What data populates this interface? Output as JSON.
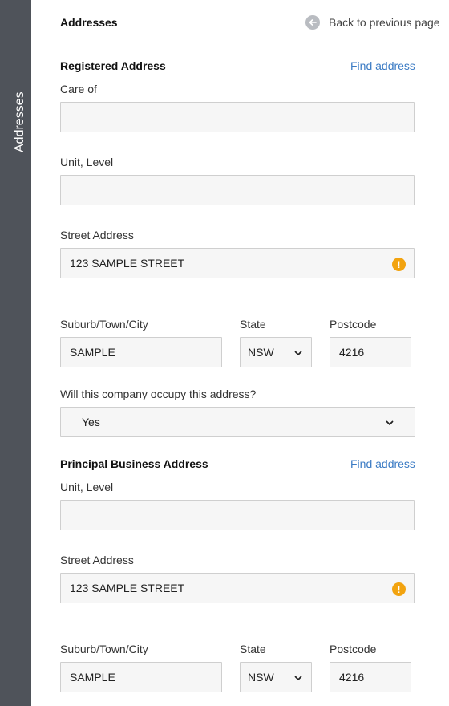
{
  "sidebar": {
    "label": "Addresses"
  },
  "header": {
    "title": "Addresses",
    "back_label": "Back to previous page"
  },
  "registered": {
    "title": "Registered Address",
    "find_label": "Find address",
    "care_of_label": "Care of",
    "care_of_value": "",
    "unit_label": "Unit, Level",
    "unit_value": "",
    "street_label": "Street Address",
    "street_value": "123 SAMPLE STREET",
    "suburb_label": "Suburb/Town/City",
    "suburb_value": "SAMPLE",
    "state_label": "State",
    "state_value": "NSW",
    "postcode_label": "Postcode",
    "postcode_value": "4216",
    "occupy_label": "Will this company occupy this address?",
    "occupy_value": "Yes"
  },
  "principal": {
    "title": "Principal Business Address",
    "find_label": "Find address",
    "unit_label": "Unit, Level",
    "unit_value": "",
    "street_label": "Street Address",
    "street_value": "123 SAMPLE STREET",
    "suburb_label": "Suburb/Town/City",
    "suburb_value": "SAMPLE",
    "state_label": "State",
    "state_value": "NSW",
    "postcode_label": "Postcode",
    "postcode_value": "4216"
  },
  "warning_glyph": "!",
  "colors": {
    "sidebar": "#4f535a",
    "link": "#3b7bc4",
    "warning": "#f2a30f",
    "field_bg": "#f6f6f6"
  }
}
